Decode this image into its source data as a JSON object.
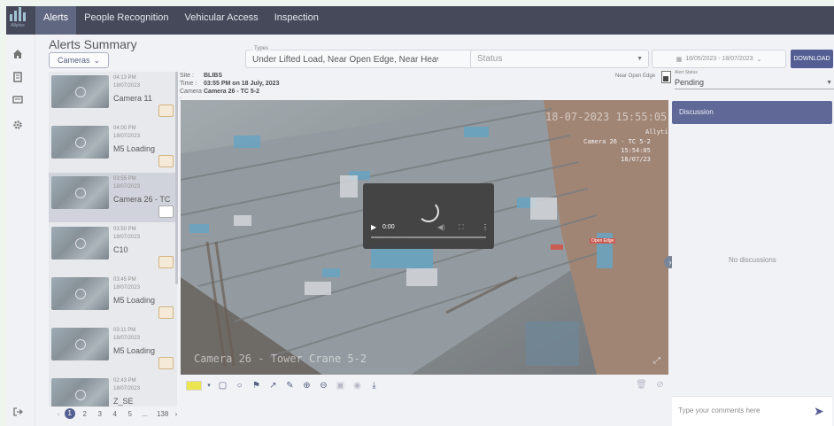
{
  "app": {
    "brand": "Allytics",
    "nav": [
      "Alerts",
      "People Recognition",
      "Vehicular Access",
      "Inspection"
    ],
    "active_tab": "Alerts"
  },
  "sidebar": {
    "icons": [
      "home-icon",
      "report-icon",
      "chat-icon",
      "settings-icon",
      "logout-icon"
    ]
  },
  "page": {
    "title": "Alerts Summary",
    "cameras_btn": "Cameras"
  },
  "filters": {
    "types_label": "Types",
    "types_value": "Under Lifted Load, Near Open Edge, Near Heavy Mach...",
    "status_placeholder": "Status",
    "date_range": "18/05/2023 - 18/07/2023",
    "download": "DOWNLOAD"
  },
  "alerts": [
    {
      "time": "04:13 PM",
      "date": "18/07/2023",
      "camera": "Camera 11",
      "selected": false
    },
    {
      "time": "04:00 PM",
      "date": "18/07/2023",
      "camera": "M5 Loading",
      "selected": false
    },
    {
      "time": "03:55 PM",
      "date": "18/07/2023",
      "camera": "Camera 26 - TC",
      "selected": true
    },
    {
      "time": "03:50 PM",
      "date": "18/07/2023",
      "camera": "C10",
      "selected": false
    },
    {
      "time": "03:45 PM",
      "date": "18/07/2023",
      "camera": "M5 Loading",
      "selected": false
    },
    {
      "time": "03:11 PM",
      "date": "18/07/2023",
      "camera": "M5 Loading",
      "selected": false
    },
    {
      "time": "02:43 PM",
      "date": "18/07/2023",
      "camera": "Z_SE",
      "selected": false
    }
  ],
  "pagination": {
    "pages": [
      "1",
      "2",
      "3",
      "4",
      "5",
      "...",
      "138"
    ],
    "current": "1"
  },
  "details": {
    "site_label": "Site :",
    "site": "BLIBS",
    "time_label": "Time :",
    "time": "03:55 PM on 18 July, 2023",
    "camera_label": "Camera :",
    "camera": "Camera 26 - TC 5-2",
    "alert_type": "Near Open Edge",
    "alert_status_label": "Alert Status",
    "alert_status": "Pending"
  },
  "video": {
    "overlay_timestamp": "18-07-2023 15:55:05",
    "overlay_brand": "Allytics",
    "overlay_cam_lines": [
      "Camera 26 - TC 5-2",
      "15:54:05",
      "18/07/23"
    ],
    "overlay_bottom": "Camera 26 - Tower Crane 5-2",
    "edge_tag": "Open Edge",
    "player_time": "0:00"
  },
  "discussion": {
    "title": "Discussion",
    "empty": "No discussions",
    "placeholder": "Type your comments here"
  }
}
